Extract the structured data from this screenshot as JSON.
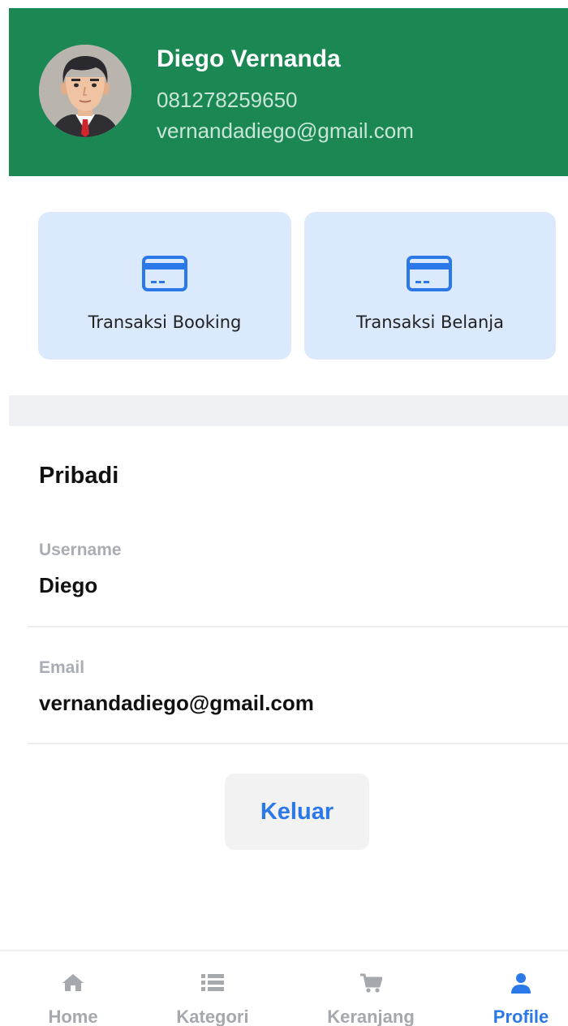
{
  "header": {
    "name": "Diego Vernanda",
    "phone": "081278259650",
    "email": "vernandadiego@gmail.com",
    "avatar_icon": "user-avatar",
    "background_color": "#1b8753"
  },
  "menu_tiles": [
    {
      "label": "Transaksi Booking",
      "icon": "credit-card-icon"
    },
    {
      "label": "Transaksi Belanja",
      "icon": "credit-card-icon"
    }
  ],
  "personal": {
    "title": "Pribadi",
    "fields": [
      {
        "label": "Username",
        "value": "Diego"
      },
      {
        "label": "Email",
        "value": "vernandadiego@gmail.com"
      }
    ]
  },
  "logout_label": "Keluar",
  "tabs": [
    {
      "label": "Home",
      "icon": "home-icon",
      "active": false
    },
    {
      "label": "Kategori",
      "icon": "list-icon",
      "active": false
    },
    {
      "label": "Keranjang",
      "icon": "cart-icon",
      "active": false
    },
    {
      "label": "Profile",
      "icon": "user-icon",
      "active": true
    }
  ],
  "colors": {
    "accent": "#2b78e8",
    "tile_background": "#dbe9fd",
    "inactive_tab": "#a5a8ad"
  }
}
